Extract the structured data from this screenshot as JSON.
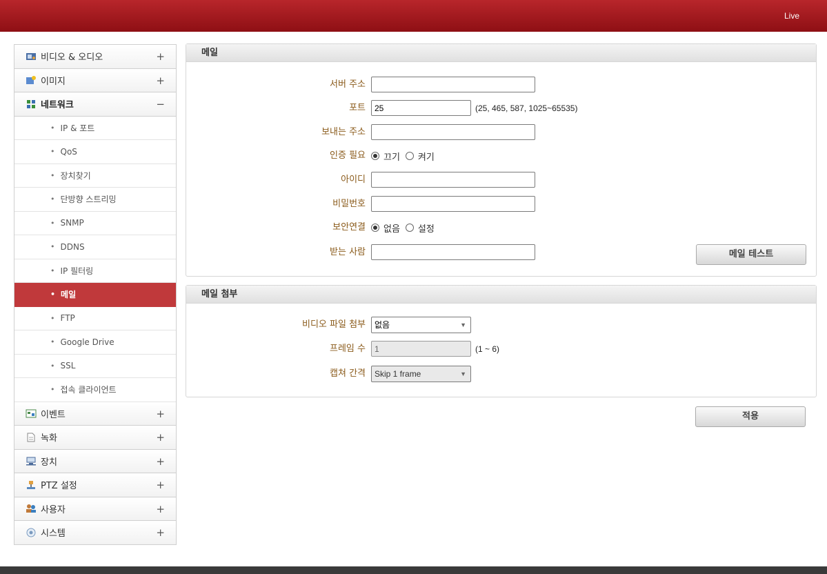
{
  "header": {
    "live_label": "Live"
  },
  "sidebar": {
    "video_audio": {
      "label": "비디오 & 오디오",
      "toggle": "+"
    },
    "image": {
      "label": "이미지",
      "toggle": "+"
    },
    "network": {
      "label": "네트워크",
      "toggle": "−"
    },
    "network_items": [
      {
        "label": "IP & 포트"
      },
      {
        "label": "QoS"
      },
      {
        "label": "장치찾기"
      },
      {
        "label": "단방향 스트리밍"
      },
      {
        "label": "SNMP"
      },
      {
        "label": "DDNS"
      },
      {
        "label": "IP 필터링"
      },
      {
        "label": "메일"
      },
      {
        "label": "FTP"
      },
      {
        "label": "Google Drive"
      },
      {
        "label": "SSL"
      },
      {
        "label": "접속 클라이언트"
      }
    ],
    "event": {
      "label": "이벤트",
      "toggle": "+"
    },
    "record": {
      "label": "녹화",
      "toggle": "+"
    },
    "device": {
      "label": "장치",
      "toggle": "+"
    },
    "ptz": {
      "label": "PTZ 설정",
      "toggle": "+"
    },
    "user": {
      "label": "사용자",
      "toggle": "+"
    },
    "system": {
      "label": "시스템",
      "toggle": "+"
    },
    "bullet": "•"
  },
  "mail": {
    "title": "메일",
    "server_label": "서버 주소",
    "server_value": "",
    "port_label": "포트",
    "port_value": "25",
    "port_hint": "(25, 465, 587, 1025~65535)",
    "sender_label": "보내는 주소",
    "sender_value": "",
    "auth_label": "인증 필요",
    "auth_off": "끄기",
    "auth_on": "켜기",
    "id_label": "아이디",
    "id_value": "",
    "password_label": "비밀번호",
    "password_value": "",
    "secure_label": "보안연결",
    "secure_none": "없음",
    "secure_set": "설정",
    "recipient_label": "받는 사람",
    "recipient_value": "",
    "test_button": "메일 테스트"
  },
  "attachment": {
    "title": "메일 첨부",
    "video_label": "비디오 파일 첨부",
    "video_value": "없음",
    "frames_label": "프레임 수",
    "frames_value": "1",
    "frames_hint": "(1 ~ 6)",
    "interval_label": "캡쳐 간격",
    "interval_value": "Skip 1 frame",
    "select_arrow": "▼"
  },
  "apply_button": "적용"
}
